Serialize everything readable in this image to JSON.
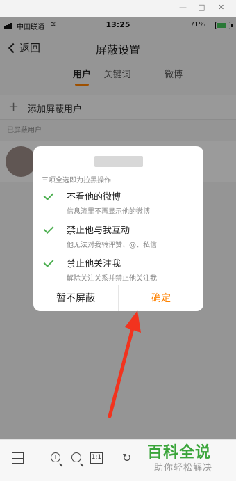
{
  "status_bar": {
    "carrier": "中国联通",
    "time": "13:25",
    "battery_percent": "71%",
    "battery_level": 0.71
  },
  "nav": {
    "back_label": "返回",
    "title": "屏蔽设置"
  },
  "tabs": [
    {
      "label": "用户",
      "active": true
    },
    {
      "label": "关键词",
      "active": false
    },
    {
      "label": "微博",
      "active": false
    }
  ],
  "add_row": {
    "label": "添加屏蔽用户"
  },
  "section_label": "已屏蔽用户",
  "dialog": {
    "hint": "三项全选即为拉黑操作",
    "options": [
      {
        "title": "不看他的微博",
        "desc": "信息流里不再显示他的微博",
        "checked": true
      },
      {
        "title": "禁止他与我互动",
        "desc": "他无法对我转评赞、@、私信",
        "checked": true
      },
      {
        "title": "禁止他关注我",
        "desc": "解除关注关系并禁止他关注我",
        "checked": true
      }
    ],
    "cancel_label": "暂不屏蔽",
    "confirm_label": "确定"
  },
  "toolbar": {
    "zoom_in": "+",
    "zoom_out": "−",
    "actual_size": "1:1",
    "rotate": "↻"
  },
  "watermark": {
    "line1": "百科全说",
    "line2": "助你轻松解决"
  },
  "colors": {
    "accent": "#ff8200",
    "check": "#4caf50",
    "arrow": "#f2331e"
  }
}
